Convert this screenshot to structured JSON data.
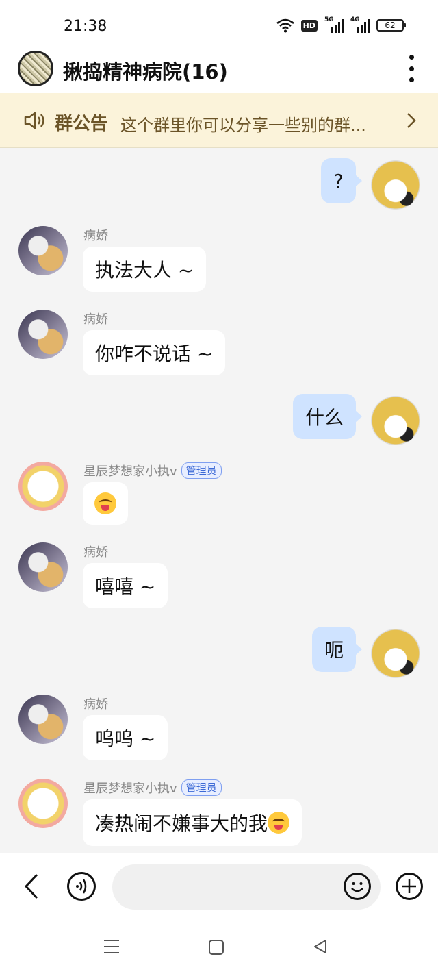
{
  "status_bar": {
    "time": "21:38",
    "hd": "HD",
    "sim1": "5G",
    "sim2": "4G",
    "battery": "62"
  },
  "header": {
    "title": "揪捣精神病院(16)",
    "more_icon": "more-vertical-icon"
  },
  "announcement": {
    "label": "群公告",
    "text": "这个群里你可以分享一些别的群...",
    "icon": "speaker-icon",
    "chevron": "chevron-right-icon"
  },
  "messages": [
    {
      "side": "out",
      "text": "?"
    },
    {
      "side": "in",
      "sender": "病娇",
      "text": "执法大人 ~"
    },
    {
      "side": "in",
      "sender": "病娇",
      "text": "你咋不说话 ~"
    },
    {
      "side": "out",
      "text": "什么"
    },
    {
      "side": "in",
      "sender": "星辰梦想家小执v",
      "badge": "管理员",
      "text": "",
      "emoji": "face-savoring-food"
    },
    {
      "side": "in",
      "sender": "病娇",
      "text": "嘻嘻 ~"
    },
    {
      "side": "out",
      "text": "呃"
    },
    {
      "side": "in",
      "sender": "病娇",
      "text": "呜呜 ~"
    },
    {
      "side": "in",
      "sender": "星辰梦想家小执v",
      "badge": "管理员",
      "text": "凑热闹不嫌事大的我",
      "emoji": "face-savoring-food"
    }
  ],
  "input_bar": {
    "placeholder": "",
    "icons": [
      "back-icon",
      "voice-icon",
      "emoji-icon",
      "plus-icon"
    ]
  },
  "colors": {
    "outgoing_bubble": "#cfe3ff",
    "incoming_bubble": "#ffffff",
    "announcement_bg": "#fbf3da",
    "admin_badge": "#3d6ad6"
  }
}
